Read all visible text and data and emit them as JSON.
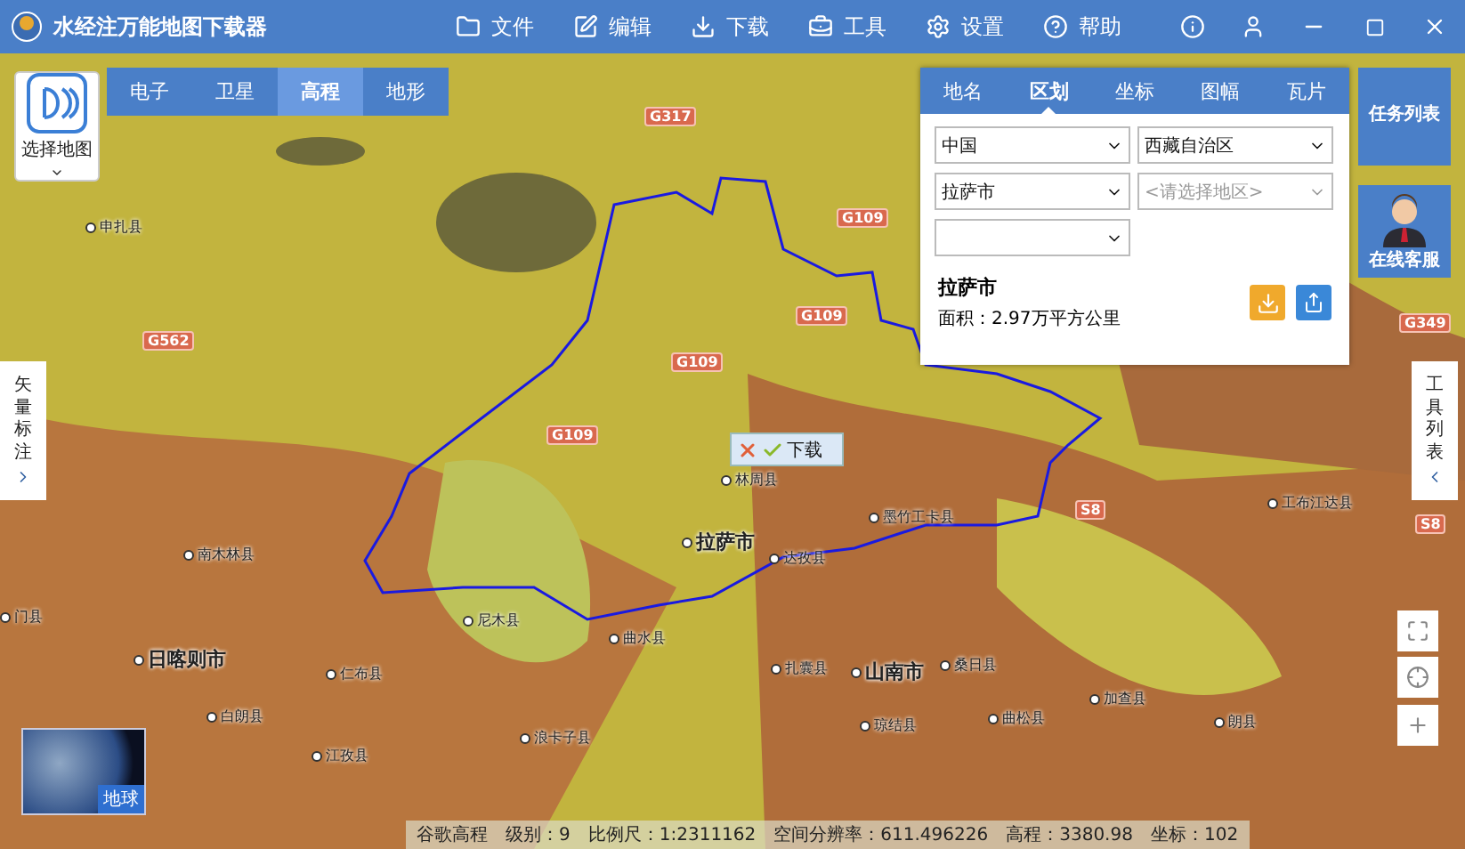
{
  "window": {
    "title": "水经注万能地图下载器"
  },
  "menu": [
    {
      "label": "文件",
      "kind": "folder"
    },
    {
      "label": "编辑",
      "kind": "edit"
    },
    {
      "label": "下载",
      "kind": "download"
    },
    {
      "label": "工具",
      "kind": "toolbox"
    },
    {
      "label": "设置",
      "kind": "gear"
    },
    {
      "label": "帮助",
      "kind": "help"
    }
  ],
  "select_map": {
    "label": "选择地图"
  },
  "map_types": [
    {
      "label": "电子",
      "selected": false
    },
    {
      "label": "卫星",
      "selected": false
    },
    {
      "label": "高程",
      "selected": true
    },
    {
      "label": "地形",
      "selected": false
    }
  ],
  "search_panel": {
    "tabs": [
      {
        "label": "地名",
        "selected": false
      },
      {
        "label": "区划",
        "selected": true
      },
      {
        "label": "坐标",
        "selected": false
      },
      {
        "label": "图幅",
        "selected": false
      },
      {
        "label": "瓦片",
        "selected": false
      }
    ],
    "selects": [
      {
        "value": "中国"
      },
      {
        "value": "西藏自治区"
      },
      {
        "value": "拉萨市"
      },
      {
        "placeholder": "<请选择地区>"
      }
    ],
    "result": {
      "name": "拉萨市",
      "area": "面积：2.97万平方公里"
    }
  },
  "task_list": {
    "label": "任务列表"
  },
  "online_service": {
    "label": "在线客服"
  },
  "vector_labels": {
    "label": "矢量标注"
  },
  "tool_list": {
    "label": "工具列表"
  },
  "popup": {
    "label": "下载"
  },
  "map": {
    "roads": [
      "G317",
      "G109",
      "G562",
      "G109",
      "G109",
      "G109",
      "S8",
      "S8",
      "G349"
    ],
    "places": [
      {
        "name": "申扎县",
        "kind": "county"
      },
      {
        "name": "林周县",
        "kind": "county"
      },
      {
        "name": "拉萨市",
        "kind": "city"
      },
      {
        "name": "达孜县",
        "kind": "county"
      },
      {
        "name": "墨竹工卡县",
        "kind": "county"
      },
      {
        "name": "工布江达县",
        "kind": "county"
      },
      {
        "name": "南木林县",
        "kind": "county"
      },
      {
        "name": "门县",
        "kind": "county"
      },
      {
        "name": "日喀则市",
        "kind": "city"
      },
      {
        "name": "尼木县",
        "kind": "county"
      },
      {
        "name": "曲水县",
        "kind": "county"
      },
      {
        "name": "仁布县",
        "kind": "county"
      },
      {
        "name": "扎囊县",
        "kind": "county"
      },
      {
        "name": "山南市",
        "kind": "city"
      },
      {
        "name": "桑日县",
        "kind": "county"
      },
      {
        "name": "白朗县",
        "kind": "county"
      },
      {
        "name": "琼结县",
        "kind": "county"
      },
      {
        "name": "加查县",
        "kind": "county"
      },
      {
        "name": "曲松县",
        "kind": "county"
      },
      {
        "name": "朗县",
        "kind": "county"
      },
      {
        "name": "浪卡子县",
        "kind": "county"
      },
      {
        "name": "江孜县",
        "kind": "county"
      }
    ]
  },
  "globe": {
    "label": "地球"
  },
  "status_bar": [
    "谷歌高程",
    "级别：9",
    "比例尺：1:2311162",
    "空间分辨率：611.496226",
    "高程：3380.98",
    "坐标：102"
  ]
}
